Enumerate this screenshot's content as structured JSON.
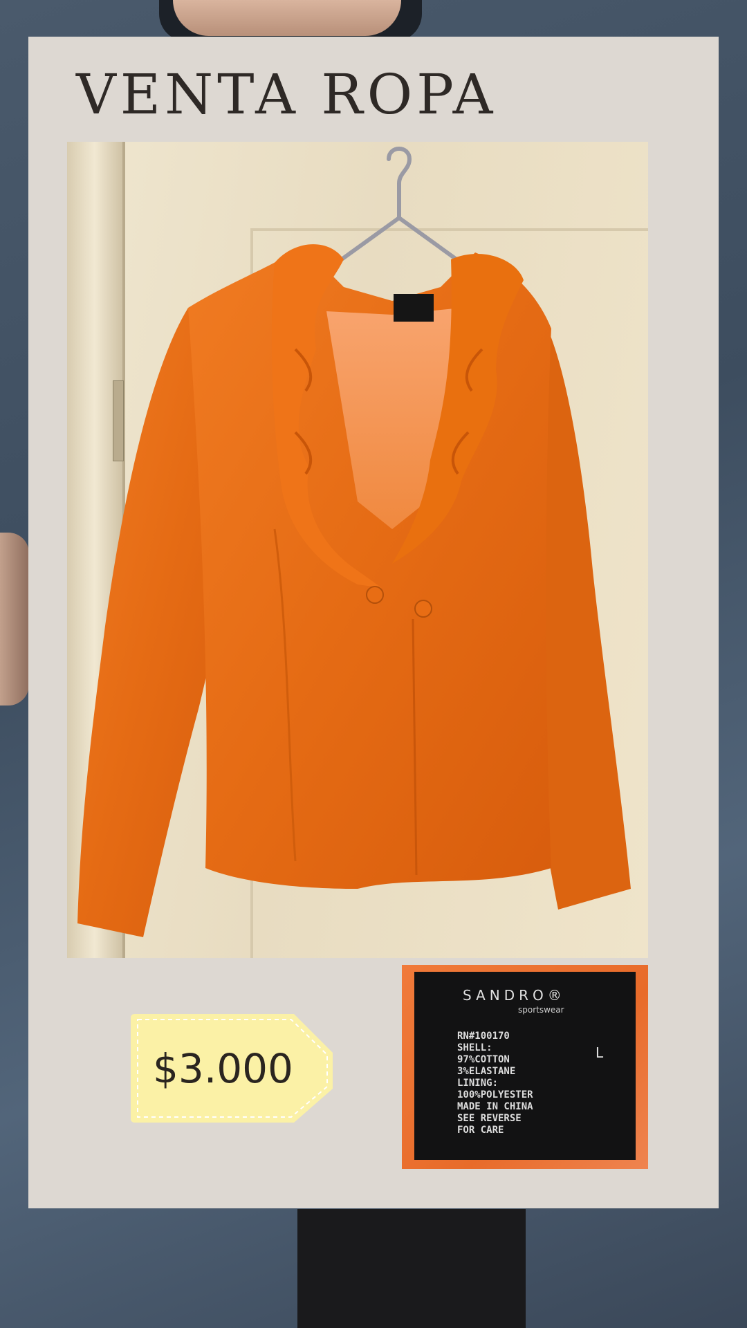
{
  "title": "VENTA ROPA",
  "price": "$3.000",
  "product_image": "orange-ruffle-jacket-photo",
  "tag_image": {
    "brand": "SANDRO",
    "brand_mark": "®",
    "line": "sportswear",
    "size": "L",
    "care_lines": [
      "RN#100170",
      "SHELL:",
      "97%COTTON",
      "3%ELASTANE",
      "LINING:",
      "100%POLYESTER",
      "MADE IN CHINA",
      "SEE REVERSE",
      "FOR CARE"
    ]
  },
  "colors": {
    "card": "#ddd8d2",
    "title": "#2e2926",
    "jacket": "#e8701e",
    "price_tag": "#fbf1a6",
    "background": "#4a5a6c"
  }
}
